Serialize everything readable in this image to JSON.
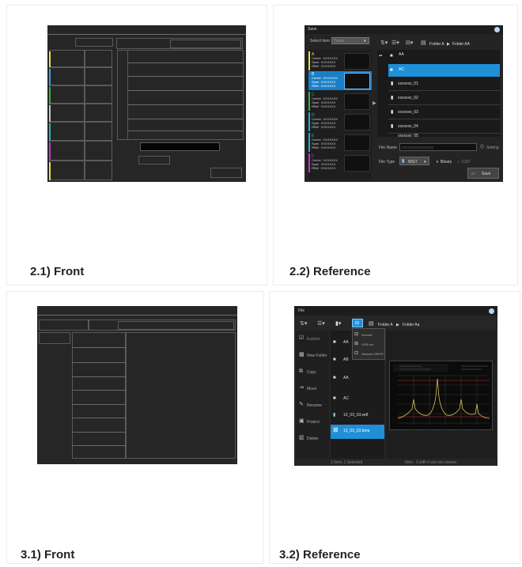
{
  "captions": {
    "p21": "2.1) Front",
    "p22": "2.2) Reference",
    "p31": "3.1) Front",
    "p32": "3.2) Reference"
  },
  "save_dialog": {
    "title": "Save",
    "select_item_label": "Select Item",
    "select_item_value": "Trace",
    "breadcrumb": [
      "Folder A",
      "Folder AA"
    ],
    "entries": [
      "AA",
      "AC",
      "xxxxxxx_01",
      "xxxxxxx_02",
      "xxxxxxx_03",
      "xxxxxxx_04",
      "xxxxxxx_05"
    ],
    "selected_entry": "AC",
    "file_name_label": "File Name",
    "file_name_placeholder": "xxxxxxxxxxxxxxxx",
    "setting_label": "Setting",
    "file_type_label": "File Type",
    "file_type_value": "WGT",
    "format_options": [
      "Binary",
      "CSV"
    ],
    "selected_format": "Binary",
    "save_button": "Save",
    "trace_labels": [
      "A",
      "B",
      "C",
      "D",
      "E",
      "F"
    ],
    "trace_field_text": "Center  XXXXXXX\nSpan  XXXXXXX\nRBW  XXXXXXX",
    "trace_colors": [
      "#e8e24a",
      "#3aa0e8",
      "#2fb84a",
      "#1fb8c8",
      "#c838c8",
      "#e8e24a"
    ]
  },
  "file_dialog": {
    "title": "File",
    "breadcrumb": [
      "Folder A",
      "Folder Aa"
    ],
    "sidebar": [
      "Explore",
      "New Folder",
      "Copy",
      "Move",
      "Rename",
      "Protect",
      "Delete"
    ],
    "drive_menu": [
      "Internal",
      "USB xxx",
      "Network DRIVE"
    ],
    "entries": [
      "AA",
      "AB",
      "AC",
      "13_03_03.wdf",
      "13_03_03.bmp"
    ],
    "selected_entry": "13_03_03.bmp",
    "status_left": "1 Item, 1 Selected",
    "status_right": "Item : 1 with 0 xxx xxx xxxxxx"
  }
}
